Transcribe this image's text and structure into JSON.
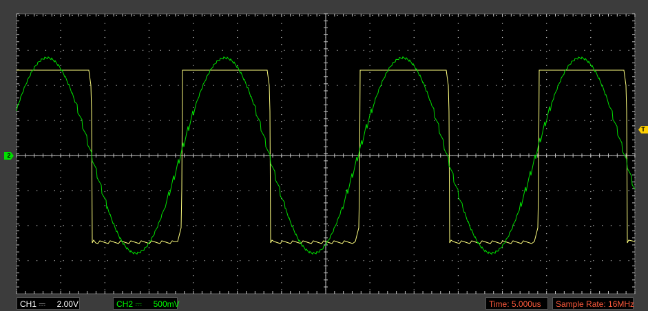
{
  "channels": {
    "ch1": {
      "label": "CH1",
      "coupling_symbol": "⎓",
      "scale": "2.00V",
      "color": "#ffff80"
    },
    "ch2": {
      "label": "CH2",
      "coupling_symbol": "⎓",
      "scale": "500mV",
      "color": "#00e000"
    }
  },
  "markers": {
    "ch2": "2",
    "trigger": "T"
  },
  "timebase": {
    "label": "Time:",
    "value": "5.000us"
  },
  "sample_rate": {
    "label": "Sample Rate:",
    "value": "16MHz"
  },
  "colors": {
    "grid": "#c8c8c8",
    "screen_bg": "#000000",
    "status_accent": "#ff5a3c"
  }
}
